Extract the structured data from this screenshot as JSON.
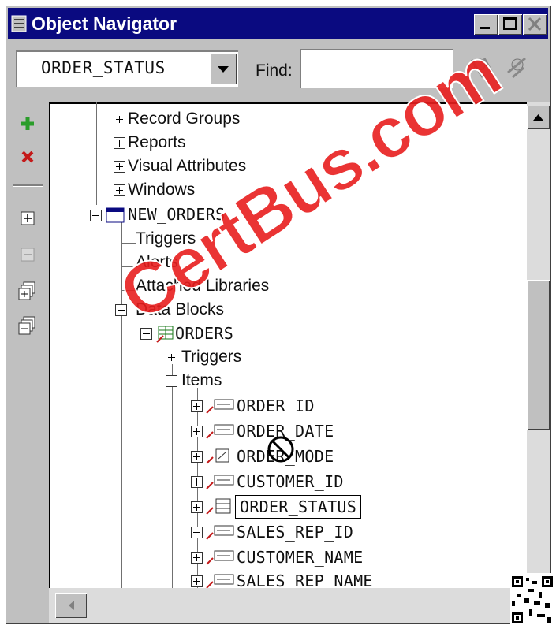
{
  "window": {
    "title": "Object Navigator"
  },
  "toolbar": {
    "combo_value": "ORDER_STATUS",
    "find_label": "Find:",
    "find_value": ""
  },
  "tree": {
    "nodes": [
      {
        "label": "Record Groups"
      },
      {
        "label": "Reports"
      },
      {
        "label": "Visual Attributes"
      },
      {
        "label": "Windows"
      },
      {
        "label": "NEW_ORDERS"
      },
      {
        "label": "Triggers"
      },
      {
        "label": "Alerts"
      },
      {
        "label": "Attached Libraries"
      },
      {
        "label": "Data Blocks"
      },
      {
        "label": "ORDERS"
      },
      {
        "label": "Triggers"
      },
      {
        "label": "Items"
      },
      {
        "label": "ORDER_ID"
      },
      {
        "label": "ORDER_DATE"
      },
      {
        "label": "ORDER_MODE"
      },
      {
        "label": "CUSTOMER_ID"
      },
      {
        "label": "ORDER_STATUS"
      },
      {
        "label": "SALES_REP_ID"
      },
      {
        "label": "CUSTOMER_NAME"
      },
      {
        "label": "SALES_REP_NAME"
      }
    ]
  },
  "watermark": {
    "text": "CertBus.com",
    "color": "#e81e1e"
  },
  "colors": {
    "titlebar": "#0a0a80",
    "window": "#c0c0c0"
  },
  "icons": [
    "form-icon",
    "minimize-icon",
    "maximize-icon",
    "close-icon",
    "dropdown-arrow-icon",
    "search-previous-icon",
    "search-next-icon",
    "create-icon",
    "delete-icon",
    "expand-all-icon",
    "collapse-all-icon",
    "expand-icon",
    "collapse-icon",
    "block-icon",
    "text-item-icon",
    "list-item-icon",
    "no-drop-cursor-icon",
    "qr-code-icon"
  ]
}
